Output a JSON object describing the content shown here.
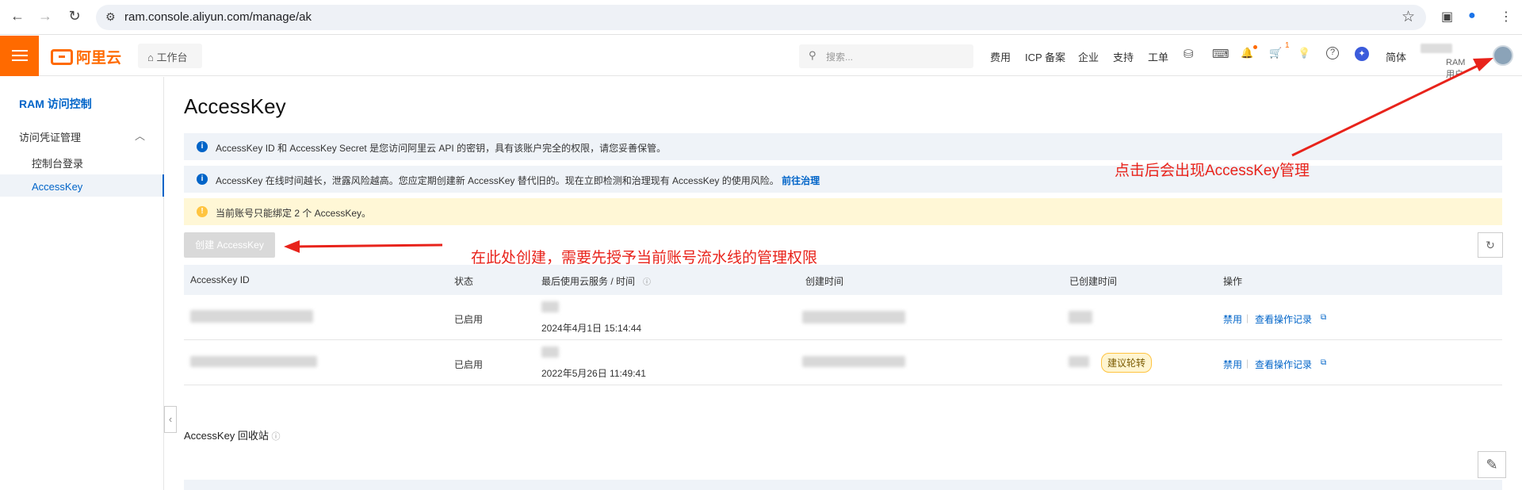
{
  "browser": {
    "url": "ram.console.aliyun.com/manage/ak",
    "back_icon": "←",
    "forward_icon": "→",
    "reload_icon": "↻",
    "tune_icon": "⚙",
    "star_icon": "☆",
    "sidepanel_icon": "▣",
    "profile_icon": "●",
    "menu_icon": "⋮"
  },
  "topbar": {
    "logo_text": "阿里云",
    "workbench_icon": "⌂",
    "workbench_label": "工作台",
    "search_icon": "⚲",
    "search_placeholder": "搜索...",
    "nav": [
      "费用",
      "ICP 备案",
      "企业",
      "支持",
      "工单"
    ],
    "cart_count": "1",
    "lang": "简体",
    "account_role": "RAM 用户",
    "icons": {
      "finance": "⛁",
      "terminal": "⌨",
      "bell": "🔔",
      "cart": "🛒",
      "bulb": "💡",
      "help": "?",
      "ai": "✦"
    }
  },
  "sidebar": {
    "title": "RAM 访问控制",
    "group": "访问凭证管理",
    "chevron": "︿",
    "items": [
      "控制台登录",
      "AccessKey"
    ],
    "collapse_icon": "‹"
  },
  "main": {
    "title": "AccessKey",
    "alerts": [
      {
        "icon": "i",
        "text": "AccessKey ID 和 AccessKey Secret 是您访问阿里云 API 的密钥，具有该账户完全的权限，请您妥善保管。"
      },
      {
        "icon": "i",
        "text": "AccessKey 在线时间越长，泄露风险越高。您应定期创建新 AccessKey 替代旧的。现在立即检测和治理现有 AccessKey 的使用风险。",
        "link": "前往治理"
      },
      {
        "icon": "!",
        "text": "当前账号只能绑定 2 个 AccessKey。"
      }
    ],
    "create_button": "创建 AccessKey",
    "refresh_icon": "↻",
    "table": {
      "headers": [
        "AccessKey ID",
        "状态",
        "最后使用云服务 / 时间",
        "创建时间",
        "已创建时间",
        "操作"
      ],
      "header_help_icon": "ⓘ",
      "rows": [
        {
          "status": "已启用",
          "last_used": "2024年4月1日 15:14:44",
          "tag": "",
          "actions": [
            "禁用",
            "查看操作记录"
          ]
        },
        {
          "status": "已启用",
          "last_used": "2022年5月26日 11:49:41",
          "tag": "建议轮转",
          "actions": [
            "禁用",
            "查看操作记录"
          ]
        }
      ],
      "external_icon": "⧉"
    },
    "recycle_title": "AccessKey 回收站",
    "recycle_help_icon": "ⓘ",
    "edit_icon": "✎"
  },
  "annotations": {
    "top_right": "点击后会出现AccessKey管理",
    "create": "在此处创建，需要先授予当前账号流水线的管理权限",
    "color": "#e8231b"
  },
  "colors": {
    "brand": "#ff6a00",
    "link": "#0064c8"
  }
}
